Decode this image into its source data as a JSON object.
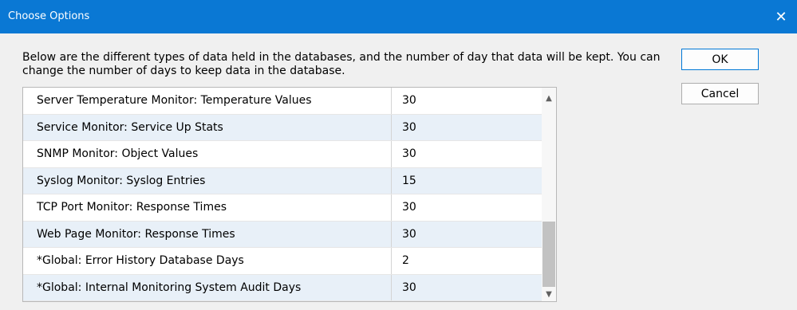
{
  "window": {
    "title": "Choose Options",
    "close_glyph": "✕",
    "titlebar_color": "#0a78d4"
  },
  "description": "Below are the different types of data held in the databases, and the number of day that data will be kept.  You can change the number of days to keep data in the database.",
  "buttons": {
    "ok": "OK",
    "cancel": "Cancel"
  },
  "table": {
    "rows": [
      {
        "name": "Server Temperature Monitor: Temperature Values",
        "days": "30"
      },
      {
        "name": "Service Monitor: Service Up Stats",
        "days": "30"
      },
      {
        "name": "SNMP Monitor: Object Values",
        "days": "30"
      },
      {
        "name": "Syslog Monitor: Syslog Entries",
        "days": "15"
      },
      {
        "name": "TCP Port Monitor: Response Times",
        "days": "30"
      },
      {
        "name": "Web Page Monitor: Response Times",
        "days": "30"
      },
      {
        "name": "*Global: Error History Database Days",
        "days": "2"
      },
      {
        "name": "*Global: Internal Monitoring System Audit Days",
        "days": "30"
      }
    ]
  },
  "scrollbar": {
    "up_icon": "chevron-up-icon",
    "down_icon": "chevron-down-icon"
  }
}
